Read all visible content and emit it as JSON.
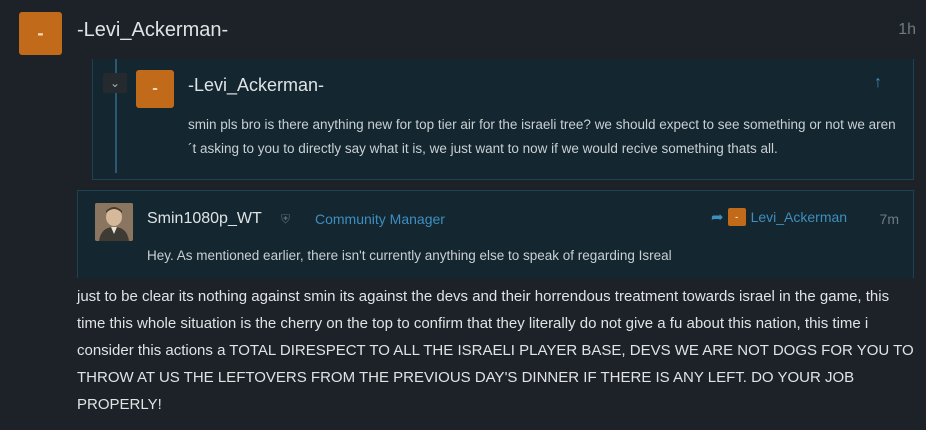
{
  "post": {
    "author": "-Levi_Ackerman-",
    "avatar_letter": "-",
    "time": "1h",
    "body": "just to be clear its nothing against smin its against the devs and their horrendous treatment towards israel in the game, this time this whole situation is the cherry on the top to confirm that they literally do not give a fu about this nation, this time i consider this actions a TOTAL DIRESPECT TO ALL THE ISRAELI PLAYER BASE, DEVS WE ARE NOT DOGS FOR YOU TO THROW AT US THE LEFTOVERS FROM THE PREVIOUS DAY'S DINNER IF THERE IS ANY LEFT. DO YOUR JOB PROPERLY!"
  },
  "quote": {
    "author": "-Levi_Ackerman-",
    "avatar_letter": "-",
    "toggle_icon": "chevron-down-icon",
    "jump_icon": "arrow-up-icon",
    "text": "smin pls bro is there anything new for top tier air for the israeli tree? we should expect to see something or not we aren´t asking to you to directly say what it is, we just want to now if we would recive something thats all."
  },
  "reply": {
    "author": "Smin1080p_WT",
    "role": "Community Manager",
    "reply_to": "Levi_Ackerman",
    "reply_to_avatar_letter": "-",
    "time": "7m",
    "text": "Hey. As mentioned earlier, there isn't currently anything else to speak of regarding Isreal"
  },
  "colors": {
    "background": "#1c2227",
    "accent": "#3e8fbf",
    "avatar_orange": "#c06a1a",
    "quote_background": "#14262f"
  }
}
